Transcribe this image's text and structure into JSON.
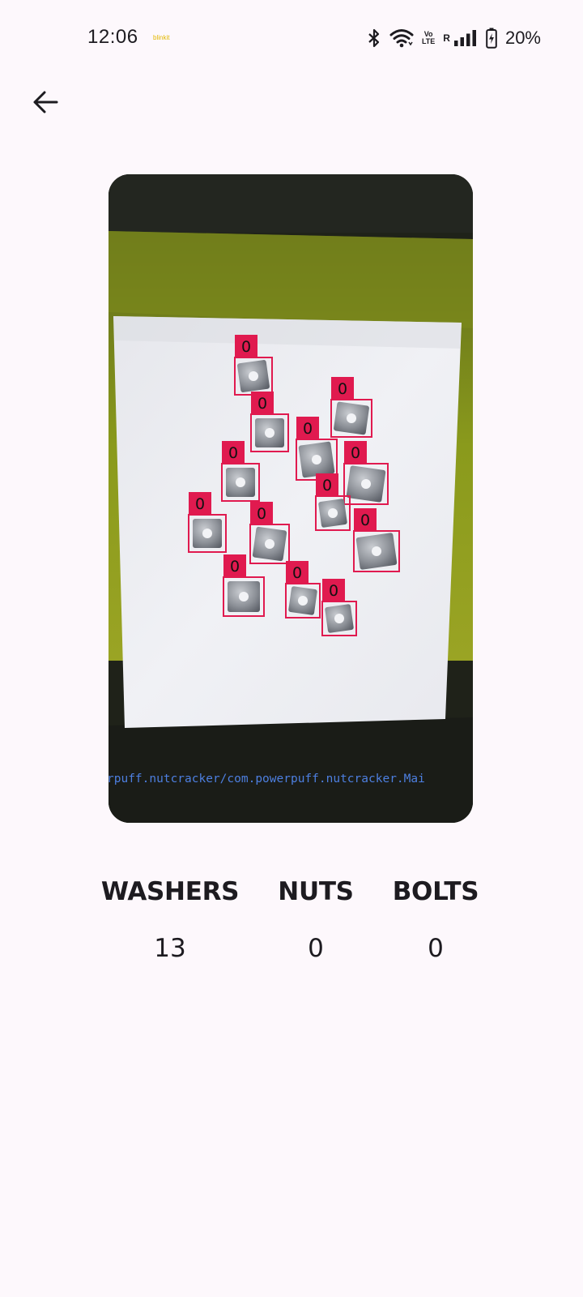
{
  "status_bar": {
    "time": "12:06",
    "app_notification": "blinkit",
    "volte": "Vo\nLTE",
    "roaming": "R",
    "battery": "20%",
    "icons": [
      "bluetooth-icon",
      "wifi-icon",
      "volte-icon",
      "signal-icon",
      "battery-charging-icon"
    ]
  },
  "nav": {
    "back_icon": "arrow-back-icon"
  },
  "photo": {
    "description_overlay_text": "rpuff.nutcracker/com.powerpuff.nutcracker.Mai",
    "detection_label": "0",
    "detection_count": 13,
    "box_color": "#e01a4f"
  },
  "counts": [
    {
      "label": "WASHERS",
      "value": "13"
    },
    {
      "label": "NUTS",
      "value": "0"
    },
    {
      "label": "BOLTS",
      "value": "0"
    }
  ]
}
